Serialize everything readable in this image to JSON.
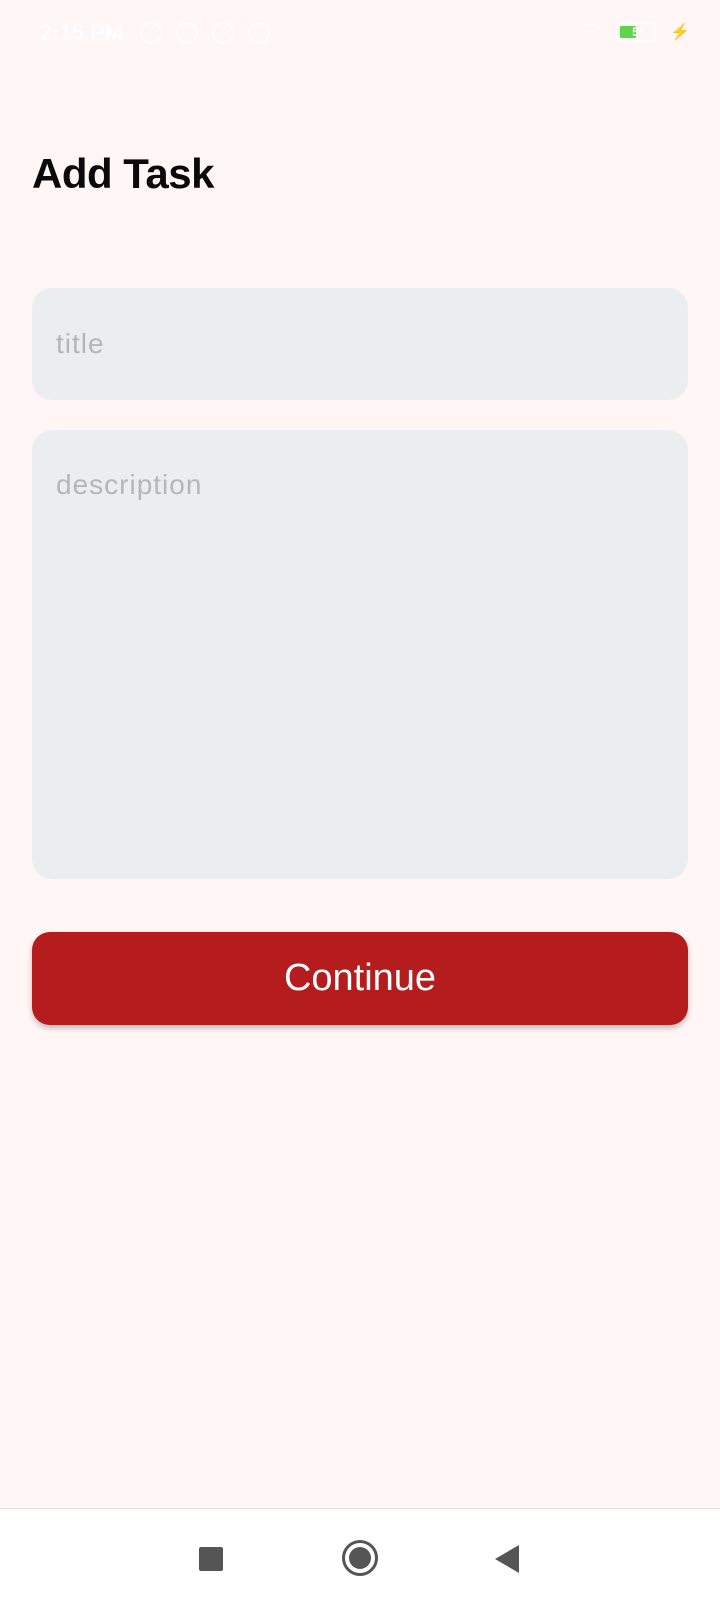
{
  "status_bar": {
    "time": "2:15 PM",
    "network_speed": "",
    "battery_level": "51",
    "battery_fraction": 0.51
  },
  "page": {
    "title": "Add Task"
  },
  "form": {
    "title_placeholder": "title",
    "title_value": "",
    "description_placeholder": "description",
    "description_value": ""
  },
  "actions": {
    "continue_label": "Continue"
  },
  "colors": {
    "background": "#fff6f5",
    "field_background": "#ebeef1",
    "accent": "#b41c1e"
  },
  "nav_bar": {
    "icons": [
      "recents-icon",
      "home-icon",
      "back-icon"
    ]
  }
}
